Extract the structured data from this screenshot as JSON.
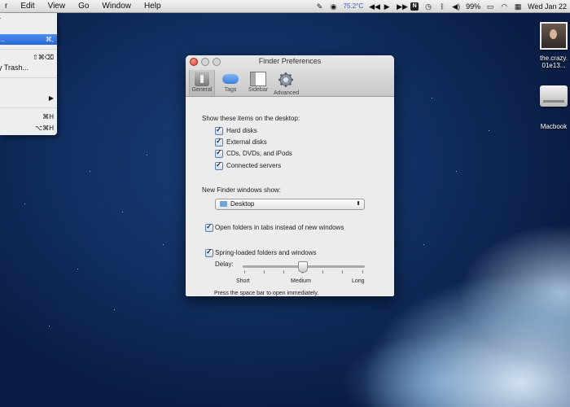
{
  "menubar": {
    "items": [
      "r",
      "Edit",
      "View",
      "Go",
      "Window",
      "Help"
    ],
    "status": {
      "temperature": "75.2°C",
      "battery": "99%",
      "datetime": "Wed Jan 22"
    }
  },
  "finder_menu": {
    "rows": [
      {
        "label": "r",
        "shortcut": "",
        "highlighted": false
      },
      {
        "label": "...",
        "shortcut": "⌘,",
        "highlighted": true
      },
      {
        "label": "",
        "shortcut": "⇧⌘⌫",
        "highlighted": false
      },
      {
        "label": "y Trash...",
        "shortcut": "",
        "highlighted": false
      },
      {
        "label": "",
        "shortcut": "▶",
        "highlighted": false
      },
      {
        "label": "",
        "shortcut": "⌘H",
        "highlighted": false
      },
      {
        "label": "",
        "shortcut": "⌥⌘H",
        "highlighted": false
      }
    ]
  },
  "desktop_icons": [
    {
      "label1": "the.crazy.",
      "label2": "01e13..."
    },
    {
      "label1": "Macbook",
      "label2": ""
    }
  ],
  "prefs": {
    "title": "Finder Preferences",
    "tabs": [
      {
        "label": "General",
        "selected": true
      },
      {
        "label": "Tags",
        "selected": false
      },
      {
        "label": "Sidebar",
        "selected": false
      },
      {
        "label": "Advanced",
        "selected": false
      }
    ],
    "show_desktop_heading": "Show these items on the desktop:",
    "desktop_items": [
      {
        "label": "Hard disks",
        "checked": true
      },
      {
        "label": "External disks",
        "checked": true
      },
      {
        "label": "CDs, DVDs, and iPods",
        "checked": true
      },
      {
        "label": "Connected servers",
        "checked": true
      }
    ],
    "new_window_heading": "New Finder windows show:",
    "new_window_value": "Desktop",
    "open_in_tabs": {
      "label": "Open folders in tabs instead of new windows",
      "checked": true
    },
    "spring_loaded": {
      "label": "Spring-loaded folders and windows",
      "checked": true
    },
    "delay_label": "Delay:",
    "delay_ticks": [
      "Short",
      "Medium",
      "Long"
    ],
    "delay_value": "Medium",
    "hint": "Press the space bar to open immediately."
  }
}
